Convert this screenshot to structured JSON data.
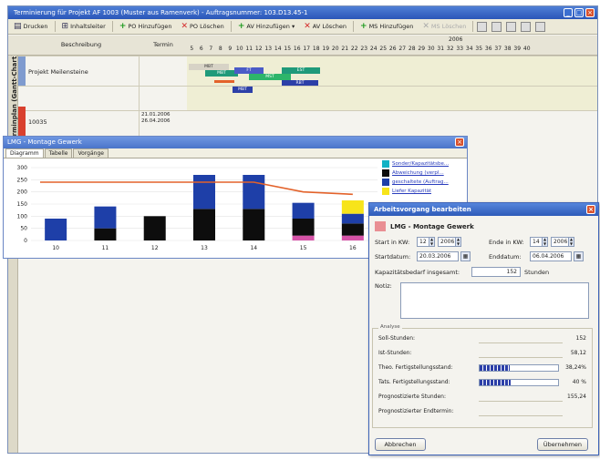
{
  "window": {
    "title": "Terminierung für Projekt AF 1003 (Muster aus Ramenverk) - Auftragsnummer: 103.D13.45-1",
    "controls": {
      "minimize": "_",
      "maximize": "□",
      "close": "×"
    }
  },
  "toolbar": {
    "items": [
      {
        "icon": "print-icon",
        "label": "Drucken"
      },
      {
        "icon": "tree-icon",
        "label": "Inhaltsleiter"
      },
      {
        "icon": "plus-icon",
        "label": "PO Hinzufügen"
      },
      {
        "icon": "delete-icon",
        "label": "PO Löschen"
      },
      {
        "icon": "plus-icon",
        "label": "AV Hinzufügen ▾"
      },
      {
        "icon": "delete-icon",
        "label": "AV Löschen"
      },
      {
        "icon": "plus-icon",
        "label": "MS Hinzufügen"
      },
      {
        "icon": "delete-icon",
        "label": "MS Löschen"
      }
    ]
  },
  "gantt": {
    "vertical_tab": "Terminplan (Gantt-Chart)",
    "columns": {
      "description": "Beschreibung",
      "date": "Termin"
    },
    "year": "2006",
    "weeks": [
      "5",
      "6",
      "7",
      "8",
      "9",
      "10",
      "11",
      "12",
      "13",
      "14",
      "15",
      "16",
      "17",
      "18",
      "19",
      "20",
      "21",
      "22",
      "23",
      "24",
      "25",
      "26",
      "27",
      "28",
      "29",
      "30",
      "31",
      "32",
      "33",
      "34",
      "35",
      "36",
      "37",
      "38",
      "39",
      "40"
    ],
    "rows": [
      {
        "label": "Projekt Meilensteine",
        "date": ""
      },
      {
        "label": "10035",
        "date": "21.01.2006\n26.04.2006"
      }
    ],
    "bars": [
      {
        "label": "MBT",
        "color": "#d7d3c6"
      },
      {
        "label": "MBT",
        "color": "#1f9a7a"
      },
      {
        "label": "FT",
        "color": "#4a5bc7"
      },
      {
        "label": "MST",
        "color": "#2db56a"
      },
      {
        "label": "EST",
        "color": "#1f9a7a"
      },
      {
        "label": "RBT",
        "color": "#2c3fa8"
      },
      {
        "label": "MBT",
        "color": "#2c3fa8"
      }
    ]
  },
  "load_window": {
    "title": "LMG - Montage Gewerk",
    "close": "×",
    "tabs": [
      "Diagramm",
      "Tabelle",
      "Vorgänge"
    ],
    "legend": [
      {
        "label": "Sonder/Kapazitätsbe...",
        "color": "#12b2c4"
      },
      {
        "label": "Abweichung (verpl...",
        "color": "#0d0d0d"
      },
      {
        "label": "geschaltete (Auftrag...",
        "color": "#1e3fa8"
      },
      {
        "label": "Liefer Kapazität",
        "color": "#f7e41a"
      }
    ]
  },
  "chart_data": {
    "type": "bar",
    "categories": [
      "10",
      "11",
      "12",
      "13",
      "14",
      "15",
      "16"
    ],
    "ylim": [
      0,
      300
    ],
    "yticks": [
      0,
      50,
      100,
      150,
      200,
      250,
      300
    ],
    "series": [
      {
        "color": "#d653a8",
        "values": [
          0,
          0,
          0,
          0,
          0,
          20,
          20
        ]
      },
      {
        "color": "#0d0d0d",
        "values": [
          0,
          50,
          100,
          130,
          130,
          70,
          50
        ]
      },
      {
        "color": "#1e3fa8",
        "values": [
          90,
          90,
          0,
          140,
          140,
          65,
          40
        ]
      },
      {
        "color": "#f7e41a",
        "values": [
          0,
          0,
          0,
          0,
          0,
          0,
          55
        ]
      }
    ],
    "capacity_line": {
      "color": "#e3622a",
      "values": [
        240,
        240,
        240,
        240,
        240,
        200,
        190
      ]
    }
  },
  "dialog": {
    "title": "Arbeitsvorgang bearbeiten",
    "close": "×",
    "name": "LMG - Montage Gewerk",
    "start_kw_label": "Start in KW:",
    "start_kw": "12",
    "start_year": "2006",
    "end_kw_label": "Ende in KW:",
    "end_kw": "14",
    "end_year": "2006",
    "start_date_label": "Startdatum:",
    "start_date": "20.03.2006",
    "end_date_label": "Enddatum:",
    "end_date": "06.04.2006",
    "capacity_label": "Kapazitätsbedarf insgesamt:",
    "capacity_value": "152",
    "capacity_unit": "Stunden",
    "notes_label": "Notiz:",
    "analysis_label": "Analyse",
    "analysis": [
      {
        "label": "Soll-Stunden:",
        "value": "152"
      },
      {
        "label": "Ist-Stunden:",
        "value": "58,12"
      },
      {
        "label": "Theo. Fertigstellungsstand:",
        "value": "38,24%",
        "progress": 0.3824
      },
      {
        "label": "Tats. Fertigstellungsstand:",
        "value": "40 %",
        "progress": 0.4
      },
      {
        "label": "Prognostizierte Stunden:",
        "value": "155,24"
      },
      {
        "label": "Prognostizierter Endtermin:",
        "value": ""
      }
    ],
    "cancel_label": "Abbrechen",
    "apply_label": "Übernehmen"
  }
}
